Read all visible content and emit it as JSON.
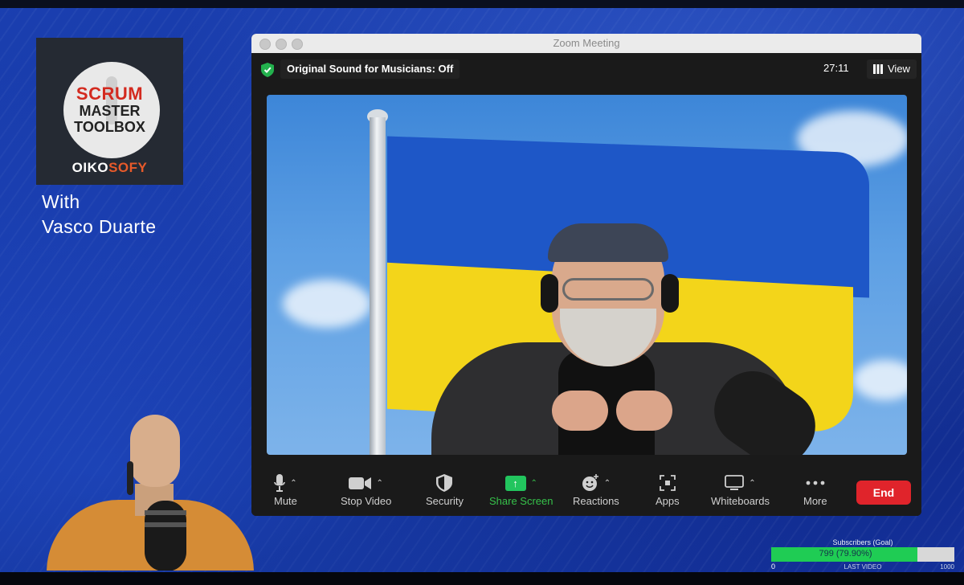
{
  "branding": {
    "logo_lines": [
      "SCRUM",
      "MASTER",
      "TOOLBOX"
    ],
    "brand_part1": "OIKO",
    "brand_part2": "SOFY",
    "host_prefix": "With",
    "host_name": "Vasco Duarte",
    "colors": {
      "logo_red": "#d32a1f",
      "brand_orange": "#e85a2a",
      "logo_bg": "#252a33"
    }
  },
  "zoom": {
    "window_title": "Zoom Meeting",
    "sound_status": "Original Sound for Musicians: Off",
    "timer": "27:11",
    "view_label": "View",
    "toolbar": {
      "mute": "Mute",
      "stop_video": "Stop Video",
      "security": "Security",
      "share_screen": "Share Screen",
      "reactions": "Reactions",
      "apps": "Apps",
      "whiteboards": "Whiteboards",
      "more": "More",
      "end": "End"
    },
    "colors": {
      "share_green": "#22c55e",
      "end_red": "#e0242b"
    }
  },
  "subscribers": {
    "label": "Subscribers (Goal)",
    "count_text": "799 (79.90%)",
    "progress": 0.799,
    "min": "0",
    "caption": "LAST VIDEO",
    "max": "1000"
  }
}
